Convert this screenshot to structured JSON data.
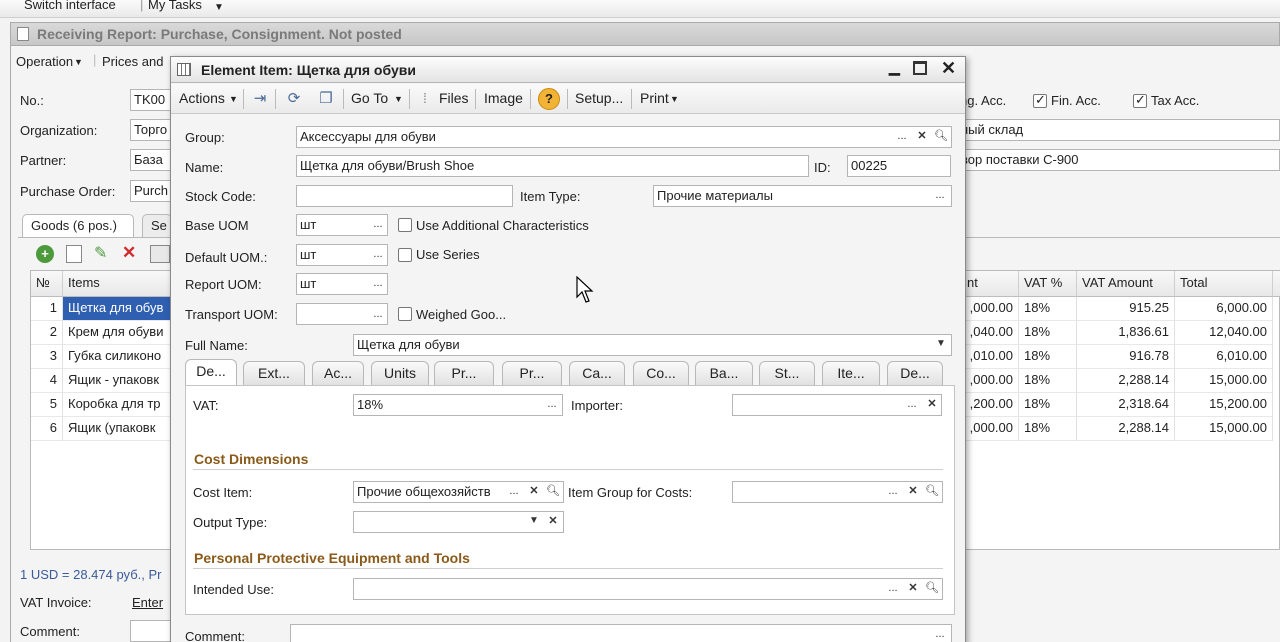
{
  "topbar": {
    "switch_interface": "Switch interface",
    "my_tasks": "My Tasks"
  },
  "back": {
    "title": "Receiving Report: Purchase, Consignment. Not posted",
    "menu": {
      "operation": "Operation",
      "prices": "Prices and"
    },
    "fields": {
      "no_label": "No.:",
      "no_value": "TK00",
      "org_label": "Organization:",
      "org_value": "Торго",
      "partner_label": "Partner:",
      "partner_value": "База",
      "po_label": "Purchase Order:",
      "po_value": "Purch"
    },
    "right": {
      "mng_acc": "ng. Acc.",
      "fin_acc": "Fin. Acc.",
      "tax_acc": "Tax Acc.",
      "warehouse": "ный склад",
      "contract": "вор поставки С-900"
    },
    "tabs": {
      "goods": "Goods (6 pos.)",
      "se": "Se"
    },
    "grid": {
      "headers": {
        "no": "№",
        "items": "Items",
        "amount": "nt",
        "vat": "VAT %",
        "vat_amount": "VAT Amount",
        "total": "Total"
      },
      "rows": [
        {
          "n": "1",
          "item": "Щетка для обув",
          "amount": ",000.00",
          "vat": "18%",
          "vat_amount": "915.25",
          "total": "6,000.00"
        },
        {
          "n": "2",
          "item": "Крем для обуви",
          "amount": ",040.00",
          "vat": "18%",
          "vat_amount": "1,836.61",
          "total": "12,040.00"
        },
        {
          "n": "3",
          "item": "Губка силиконо",
          "amount": ",010.00",
          "vat": "18%",
          "vat_amount": "916.78",
          "total": "6,010.00"
        },
        {
          "n": "4",
          "item": "Ящик - упаковк",
          "amount": ",000.00",
          "vat": "18%",
          "vat_amount": "2,288.14",
          "total": "15,000.00"
        },
        {
          "n": "5",
          "item": "Коробка для тр",
          "amount": ",200.00",
          "vat": "18%",
          "vat_amount": "2,318.64",
          "total": "15,200.00"
        },
        {
          "n": "6",
          "item": "Ящик (упаковк",
          "amount": ",000.00",
          "vat": "18%",
          "vat_amount": "2,288.14",
          "total": "15,000.00"
        }
      ]
    },
    "footer": {
      "rate": "1 USD = 28.474 руб., Pr",
      "vat_invoice_label": "VAT Invoice:",
      "vat_invoice_link": "Enter",
      "comment_label": "Comment:"
    }
  },
  "dialog": {
    "title": "Element Item: Щетка для обуви",
    "toolbar": {
      "actions": "Actions",
      "goto": "Go To",
      "files": "Files",
      "image": "Image",
      "help": "?",
      "setup": "Setup...",
      "print": "Print"
    },
    "group_label": "Group:",
    "group_value": "Аксессуары для обуви",
    "name_label": "Name:",
    "name_value": "Щетка для обуви/Brush Shoe",
    "id_label": "ID:",
    "id_value": "00225",
    "stock_label": "Stock Code:",
    "stock_value": "",
    "item_type_label": "Item Type:",
    "item_type_value": "Прочие материалы",
    "base_uom_label": "Base UOM",
    "base_uom_value": "шт",
    "use_add_char": "Use Additional Characteristics",
    "default_uom_label": "Default UOM.:",
    "default_uom_value": "шт",
    "use_series": "Use Series",
    "report_uom_label": "Report UOM:",
    "report_uom_value": "шт",
    "transport_uom_label": "Transport UOM:",
    "transport_uom_value": "",
    "weighed": "Weighed Goo...",
    "full_name_label": "Full Name:",
    "full_name_value": "Щетка для обуви",
    "tabs": [
      "De...",
      "Ext...",
      "Ac...",
      "Units",
      "Pr...",
      "Pr...",
      "Ca...",
      "Co...",
      "Ba...",
      "St...",
      "Ite...",
      "De..."
    ],
    "vat_label": "VAT:",
    "vat_value": "18%",
    "importer_label": "Importer:",
    "importer_value": "",
    "cost_dimensions": "Cost Dimensions",
    "cost_item_label": "Cost Item:",
    "cost_item_value": "Прочие общехозяйств",
    "item_group_costs_label": "Item Group for Costs:",
    "item_group_costs_value": "",
    "output_type_label": "Output Type:",
    "output_type_value": "",
    "ppe_section": "Personal Protective Equipment and Tools",
    "intended_use_label": "Intended Use:",
    "intended_use_value": "",
    "comment_label": "Comment:"
  }
}
